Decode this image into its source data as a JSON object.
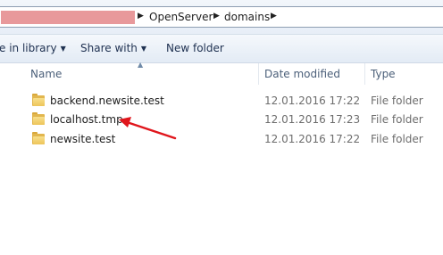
{
  "address_bar": {
    "crumbs": [
      "OpenServer",
      "domains"
    ]
  },
  "toolbar": {
    "include_in_library": "e in library",
    "share_with": "Share with",
    "new_folder": "New folder"
  },
  "columns": {
    "name": "Name",
    "date_modified": "Date modified",
    "type": "Type"
  },
  "files": [
    {
      "name": "backend.newsite.test",
      "date": "12.01.2016 17:22",
      "type": "File folder"
    },
    {
      "name": "localhost.tmp",
      "date": "12.01.2016 17:23",
      "type": "File folder"
    },
    {
      "name": "newsite.test",
      "date": "12.01.2016 17:22",
      "type": "File folder"
    }
  ],
  "colors": {
    "annotation_arrow": "#e0161c",
    "folder": "#edc45a",
    "redaction": "#e8999b"
  },
  "icons": [
    "folder-icon",
    "chevron-right-icon",
    "caret-down-icon",
    "sort-up-icon"
  ]
}
